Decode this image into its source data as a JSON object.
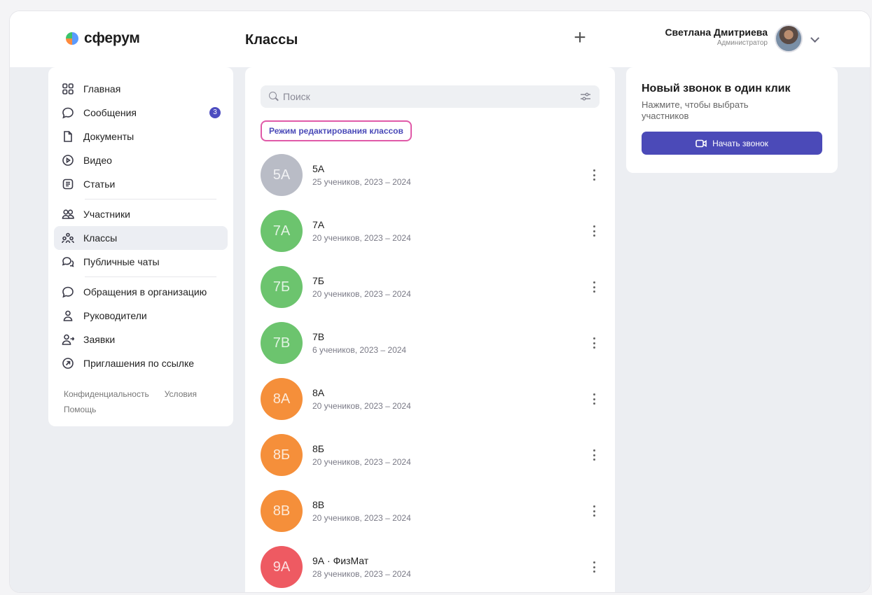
{
  "header": {
    "logo_text": "сферум",
    "title": "Классы",
    "plus_label": "+",
    "user_name": "Светлана Дмитриева",
    "user_role": "Администратор"
  },
  "sidebar": {
    "items": [
      {
        "label": "Главная",
        "icon": "home-grid-icon"
      },
      {
        "label": "Сообщения",
        "icon": "chat-icon",
        "badge": "3"
      },
      {
        "label": "Документы",
        "icon": "document-icon"
      },
      {
        "label": "Видео",
        "icon": "play-circle-icon"
      },
      {
        "label": "Статьи",
        "icon": "article-icon"
      },
      {
        "label": "Участники",
        "icon": "users-icon"
      },
      {
        "label": "Классы",
        "icon": "classes-icon",
        "active": true
      },
      {
        "label": "Публичные чаты",
        "icon": "public-chat-icon"
      },
      {
        "label": "Обращения в организацию",
        "icon": "feedback-chat-icon"
      },
      {
        "label": "Руководители",
        "icon": "person-icon"
      },
      {
        "label": "Заявки",
        "icon": "person-add-icon"
      },
      {
        "label": "Приглашения по ссылке",
        "icon": "link-arrow-icon"
      }
    ],
    "footer": {
      "privacy": "Конфиденциальность",
      "terms": "Условия",
      "help": "Помощь"
    }
  },
  "main": {
    "search_placeholder": "Поиск",
    "edit_mode_label": "Режим редактирования классов",
    "classes": [
      {
        "avatar": "5А",
        "name": "5А",
        "meta": "25 учеников, 2023 – 2024",
        "color": "#b9bcc6"
      },
      {
        "avatar": "7А",
        "name": "7А",
        "meta": "20 учеников,  2023 – 2024",
        "color": "#6cc46e"
      },
      {
        "avatar": "7Б",
        "name": "7Б",
        "meta": "20 учеников,  2023 – 2024",
        "color": "#6cc46e"
      },
      {
        "avatar": "7В",
        "name": "7В",
        "meta": "6 учеников,  2023 – 2024",
        "color": "#6cc46e"
      },
      {
        "avatar": "8А",
        "name": "8А",
        "meta": "20 учеников,  2023 – 2024",
        "color": "#f58f3a"
      },
      {
        "avatar": "8Б",
        "name": "8Б",
        "meta": "20 учеников,  2023 – 2024",
        "color": "#f58f3a"
      },
      {
        "avatar": "8В",
        "name": "8В",
        "meta": "20 учеников,  2023 – 2024",
        "color": "#f58f3a"
      },
      {
        "avatar": "9А",
        "name": "9А · ФизМат",
        "meta": "28 учеников,  2023 – 2024",
        "color": "#ee5a62"
      }
    ]
  },
  "call": {
    "title": "Новый звонок в один клик",
    "subtitle": "Нажмите, чтобы выбрать участников",
    "button_label": "Начать звонок"
  },
  "colors": {
    "accent": "#4b4ab8",
    "edit_mode_border": "#e05aa8"
  }
}
